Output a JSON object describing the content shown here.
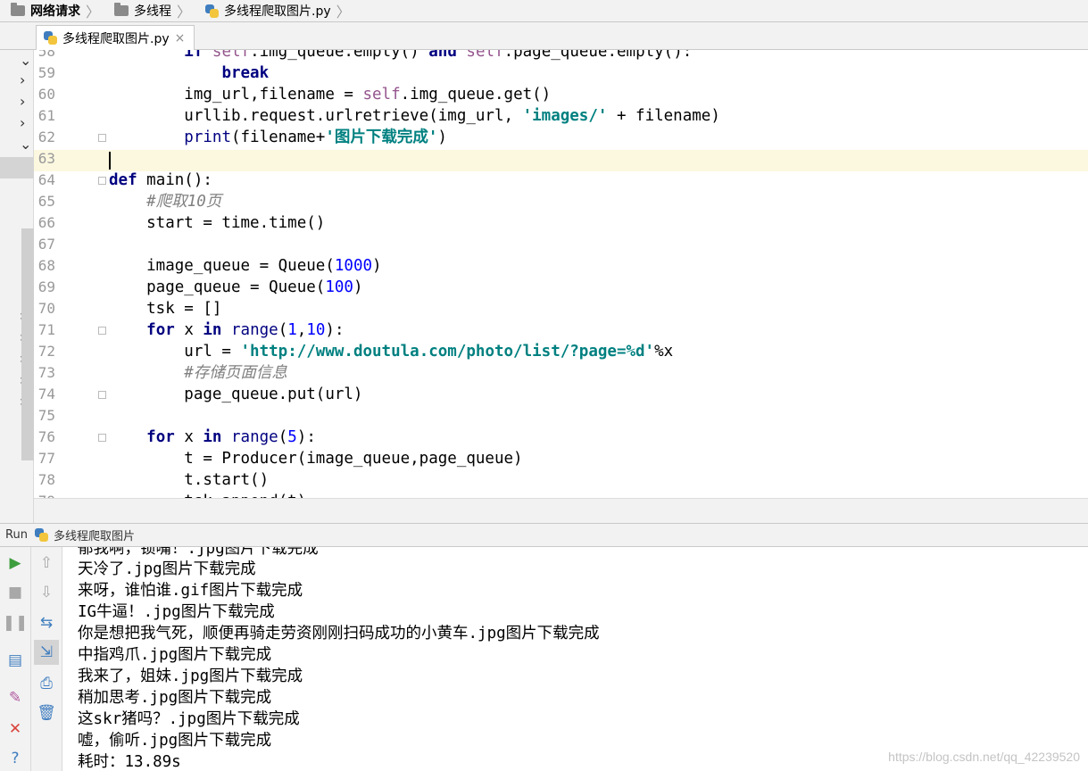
{
  "breadcrumb": {
    "items": [
      "网络请求",
      "多线程",
      "多线程爬取图片.py"
    ]
  },
  "editor_tab": {
    "label": "多线程爬取图片.py",
    "close": "×"
  },
  "code": [
    {
      "ln": "58",
      "parts": [
        [
          "",
          "        "
        ],
        [
          "kw",
          "if "
        ],
        [
          "self",
          "self"
        ],
        [
          "",
          ".img_queue.empty() "
        ],
        [
          "kw",
          "and "
        ],
        [
          "self",
          "self"
        ],
        [
          "",
          ".page_queue.empty():"
        ]
      ]
    },
    {
      "ln": "59",
      "parts": [
        [
          "",
          "            "
        ],
        [
          "kw",
          "break"
        ]
      ]
    },
    {
      "ln": "60",
      "parts": [
        [
          "",
          "        img_url,filename = "
        ],
        [
          "self",
          "self"
        ],
        [
          "",
          ".img_queue.get()"
        ]
      ]
    },
    {
      "ln": "61",
      "parts": [
        [
          "",
          "        urllib.request.urlretrieve(img_url, "
        ],
        [
          "str",
          "'images/'"
        ],
        [
          "",
          " + filename)"
        ]
      ]
    },
    {
      "ln": "62",
      "parts": [
        [
          "",
          "        "
        ],
        [
          "kw2",
          "print"
        ],
        [
          "",
          "(filename+"
        ],
        [
          "str",
          "'图片下载完成'"
        ],
        [
          "",
          ")"
        ]
      ]
    },
    {
      "ln": "63",
      "parts": [
        [
          "",
          ""
        ]
      ]
    },
    {
      "ln": "64",
      "parts": [
        [
          "kw",
          "def "
        ],
        [
          "",
          "main():"
        ]
      ]
    },
    {
      "ln": "65",
      "parts": [
        [
          "",
          "    "
        ],
        [
          "cmt",
          "#爬取10页"
        ]
      ]
    },
    {
      "ln": "66",
      "parts": [
        [
          "",
          "    start = time.time()"
        ]
      ]
    },
    {
      "ln": "67",
      "parts": [
        [
          "",
          ""
        ]
      ]
    },
    {
      "ln": "68",
      "parts": [
        [
          "",
          "    image_queue = Queue("
        ],
        [
          "num",
          "1000"
        ],
        [
          "",
          ")"
        ]
      ]
    },
    {
      "ln": "69",
      "parts": [
        [
          "",
          "    page_queue = Queue("
        ],
        [
          "num",
          "100"
        ],
        [
          "",
          ")"
        ]
      ]
    },
    {
      "ln": "70",
      "parts": [
        [
          "",
          "    tsk = []"
        ]
      ]
    },
    {
      "ln": "71",
      "parts": [
        [
          "",
          "    "
        ],
        [
          "kw",
          "for "
        ],
        [
          "",
          "x "
        ],
        [
          "kw",
          "in "
        ],
        [
          "kw2",
          "range"
        ],
        [
          "",
          "("
        ],
        [
          "num",
          "1"
        ],
        [
          "",
          ","
        ],
        [
          "num",
          "10"
        ],
        [
          "",
          "):"
        ]
      ]
    },
    {
      "ln": "72",
      "parts": [
        [
          "",
          "        url = "
        ],
        [
          "str",
          "'http://www.doutula.com/photo/list/?page=%d'"
        ],
        [
          "",
          "%x"
        ]
      ]
    },
    {
      "ln": "73",
      "parts": [
        [
          "",
          "        "
        ],
        [
          "cmt",
          "#存储页面信息"
        ]
      ]
    },
    {
      "ln": "74",
      "parts": [
        [
          "",
          "        page_queue.put(url)"
        ]
      ]
    },
    {
      "ln": "75",
      "parts": [
        [
          "",
          ""
        ]
      ]
    },
    {
      "ln": "76",
      "parts": [
        [
          "",
          "    "
        ],
        [
          "kw",
          "for "
        ],
        [
          "",
          "x "
        ],
        [
          "kw",
          "in "
        ],
        [
          "kw2",
          "range"
        ],
        [
          "",
          "("
        ],
        [
          "num",
          "5"
        ],
        [
          "",
          "):"
        ]
      ]
    },
    {
      "ln": "77",
      "parts": [
        [
          "",
          "        t = Producer(image_queue,page_queue)"
        ]
      ]
    },
    {
      "ln": "78",
      "parts": [
        [
          "",
          "        t.start()"
        ]
      ]
    },
    {
      "ln": "79",
      "parts": [
        [
          "",
          "        tsk.append(t)"
        ]
      ]
    }
  ],
  "run": {
    "label": "Run",
    "config_name": "多线程爬取图片"
  },
  "console": [
    "郁我啊，锁嘴！.jpg图片下载完成",
    "天冷了.jpg图片下载完成",
    "来呀，谁怕谁.gif图片下载完成",
    "IG牛逼！.jpg图片下载完成",
    "你是想把我气死，顺便再骑走劳资刚刚扫码成功的小黄车.jpg图片下载完成",
    "中指鸡爪.jpg图片下载完成",
    "我来了，姐妹.jpg图片下载完成",
    "稍加思考.jpg图片下载完成",
    "这skr猪吗？.jpg图片下载完成",
    "嘘，偷听.jpg图片下载完成",
    "耗时：13.89s"
  ],
  "watermark": "https://blog.csdn.net/qq_42239520",
  "colors": {
    "keyword": "#000080",
    "number": "#0000ff",
    "string": "#008080",
    "comment": "#808080",
    "self": "#94558d",
    "run_green": "#3d9e3d",
    "stop_red": "#d9433a",
    "caret_line": "#fcf8e0"
  }
}
